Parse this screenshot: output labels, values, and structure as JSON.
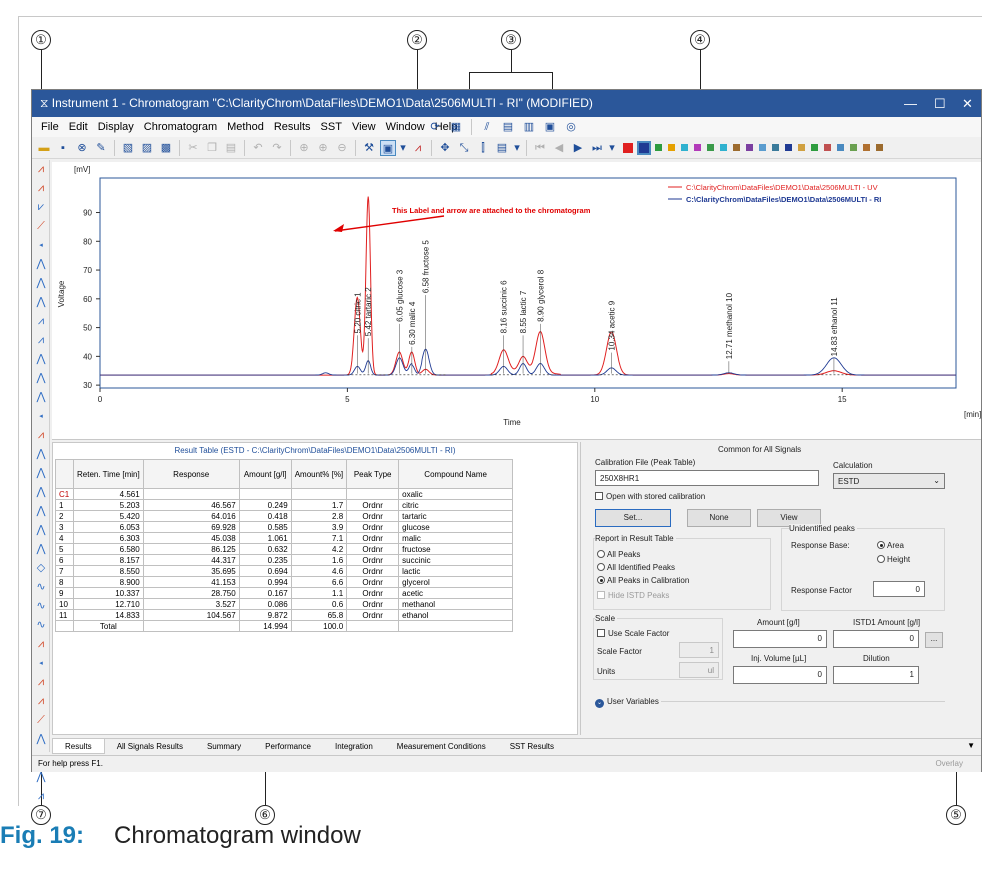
{
  "callouts": [
    "①",
    "②",
    "③",
    "④",
    "⑤",
    "⑥",
    "⑦"
  ],
  "caption": {
    "label": "Fig. 19:",
    "text": "Chromatogram window"
  },
  "window": {
    "title": "Instrument 1 - Chromatogram \"C:\\ClarityChrom\\DataFiles\\DEMO1\\Data\\2506MULTI - RI\" (MODIFIED)",
    "controls": [
      "—",
      "☐",
      "✕"
    ]
  },
  "menu": [
    "File",
    "Edit",
    "Display",
    "Chromatogram",
    "Method",
    "Results",
    "SST",
    "View",
    "Window",
    "Help"
  ],
  "colors": {
    "title_bar": "#2b579a",
    "uv_trace": "#e02020",
    "ri_trace": "#1f3a93",
    "annotation": "#e00000",
    "caption": "#1a7db5"
  },
  "toolbar": {
    "color_swatches": [
      "#e02020",
      "#1f3a93",
      "#2e9c3f",
      "#e5a000",
      "#2fb1cf",
      "#b23ab9",
      "#3a9a4a",
      "#2fb1cf",
      "#9c6b2e",
      "#7b3fa0",
      "#5a9ccf",
      "#3a7a9a",
      "#1f3a93",
      "#d0a040",
      "#2e9c3f",
      "#c05050",
      "#4a8ac0",
      "#6aa050",
      "#b07030",
      "#9c6b2e"
    ]
  },
  "chart_data": {
    "type": "line",
    "ylabel": "Voltage",
    "yunit": "[mV]",
    "xlabel": "Time",
    "xunit": "[min]",
    "xlim": [
      0,
      17.3
    ],
    "ylim": [
      29,
      102
    ],
    "xticks": [
      0,
      5,
      10,
      15
    ],
    "yticks": [
      30,
      40,
      50,
      60,
      70,
      80,
      90
    ],
    "legend": "top-right",
    "series": [
      {
        "name": "C:\\ClarityChrom\\DataFiles\\DEMO1\\Data\\2506MULTI - UV",
        "color": "#e02020",
        "baseline": 33.5,
        "peaks": [
          [
            5.2,
            27,
            0.06
          ],
          [
            5.42,
            62,
            0.045
          ],
          [
            6.05,
            8,
            0.07
          ],
          [
            6.3,
            8,
            0.06
          ],
          [
            6.58,
            2,
            0.07
          ],
          [
            8.157,
            8,
            0.09
          ],
          [
            8.55,
            5,
            0.08
          ],
          [
            8.9,
            14,
            0.09
          ],
          [
            10.337,
            15,
            0.1
          ],
          [
            12.71,
            0.5,
            0.1
          ],
          [
            14.83,
            1.5,
            0.15
          ]
        ]
      },
      {
        "name": "C:\\ClarityChrom\\DataFiles\\DEMO1\\Data\\2506MULTI - RI",
        "color": "#1f3a93",
        "baseline": 33.5,
        "peaks": [
          [
            4.561,
            0.8,
            0.06
          ],
          [
            5.203,
            3,
            0.06
          ],
          [
            5.42,
            5,
            0.05
          ],
          [
            6.053,
            6,
            0.07
          ],
          [
            6.303,
            4,
            0.06
          ],
          [
            6.58,
            9,
            0.07
          ],
          [
            8.157,
            3,
            0.08
          ],
          [
            8.55,
            4,
            0.07
          ],
          [
            8.9,
            4,
            0.08
          ],
          [
            10.337,
            2.5,
            0.09
          ],
          [
            12.71,
            0.8,
            0.1
          ],
          [
            14.833,
            6,
            0.15
          ]
        ]
      }
    ],
    "peak_labels": [
      "5.20 citric   1",
      "5.42 tartaric   2",
      "6.05 glucose   3",
      "6.30 malic   4",
      "6.58 fructose   5",
      "8.16 succinic   6",
      "8.55 lactic   7",
      "8.90 glycerol   8",
      "10.34 acetic   9",
      "12.71 methanol   10",
      "14.83 ethanol   11"
    ],
    "annotation": "This Label and arrow are attached to the chromatogram"
  },
  "result_table": {
    "title": "Result Table (ESTD - C:\\ClarityChrom\\DataFiles\\DEMO1\\Data\\2506MULTI - RI)",
    "headers": [
      "",
      "Reten. Time [min]",
      "Response",
      "Amount [g/l]",
      "Amount% [%]",
      "Peak Type",
      "Compound Name"
    ],
    "rows": [
      [
        "C1",
        "4.561",
        "",
        "",
        "",
        "",
        "oxalic"
      ],
      [
        "1",
        "5.203",
        "46.567",
        "0.249",
        "1.7",
        "Ordnr",
        "citric"
      ],
      [
        "2",
        "5.420",
        "64.016",
        "0.418",
        "2.8",
        "Ordnr",
        "tartaric"
      ],
      [
        "3",
        "6.053",
        "69.928",
        "0.585",
        "3.9",
        "Ordnr",
        "glucose"
      ],
      [
        "4",
        "6.303",
        "45.038",
        "1.061",
        "7.1",
        "Ordnr",
        "malic"
      ],
      [
        "5",
        "6.580",
        "86.125",
        "0.632",
        "4.2",
        "Ordnr",
        "fructose"
      ],
      [
        "6",
        "8.157",
        "44.317",
        "0.235",
        "1.6",
        "Ordnr",
        "succinic"
      ],
      [
        "7",
        "8.550",
        "35.695",
        "0.694",
        "4.6",
        "Ordnr",
        "lactic"
      ],
      [
        "8",
        "8.900",
        "41.153",
        "0.994",
        "6.6",
        "Ordnr",
        "glycerol"
      ],
      [
        "9",
        "10.337",
        "28.750",
        "0.167",
        "1.1",
        "Ordnr",
        "acetic"
      ],
      [
        "10",
        "12.710",
        "3.527",
        "0.086",
        "0.6",
        "Ordnr",
        "methanol"
      ],
      [
        "11",
        "14.833",
        "104.567",
        "9.872",
        "65.8",
        "Ordnr",
        "ethanol"
      ]
    ],
    "total": [
      "",
      "Total",
      "",
      "14.994",
      "100.0",
      "",
      ""
    ]
  },
  "panel": {
    "title": "Common for All Signals",
    "calib_label": "Calibration File (Peak Table)",
    "calib_value": "250X8HR1",
    "open_stored": "Open with stored calibration",
    "set_btn": "Set...",
    "none_btn": "None",
    "view_btn": "View",
    "calc_label": "Calculation",
    "calc_value": "ESTD",
    "report_label": "Report in Result Table",
    "report_opts": [
      "All Peaks",
      "All Identified Peaks",
      "All Peaks in Calibration"
    ],
    "hide_istd": "Hide ISTD Peaks",
    "unid_label": "Unidentified peaks",
    "resp_base": "Response Base:",
    "area": "Area",
    "height": "Height",
    "resp_factor": "Response Factor",
    "resp_factor_val": "0",
    "scale_label": "Scale",
    "use_scale": "Use Scale Factor",
    "scale_factor": "Scale Factor",
    "scale_factor_val": "1",
    "units": "Units",
    "units_val": "ul",
    "amount_label": "Amount [g/l]",
    "amount_val": "0",
    "istd_label": "ISTD1 Amount [g/l]",
    "istd_val": "0",
    "more_btn": "...",
    "inj_label": "Inj. Volume [µL]",
    "inj_val": "0",
    "dilution_label": "Dilution",
    "dilution_val": "1",
    "user_vars": "User Variables"
  },
  "tabs": [
    "Results",
    "All Signals Results",
    "Summary",
    "Performance",
    "Integration",
    "Measurement Conditions",
    "SST Results"
  ],
  "status": {
    "help": "For help press F1.",
    "overlay": "Overlay"
  }
}
